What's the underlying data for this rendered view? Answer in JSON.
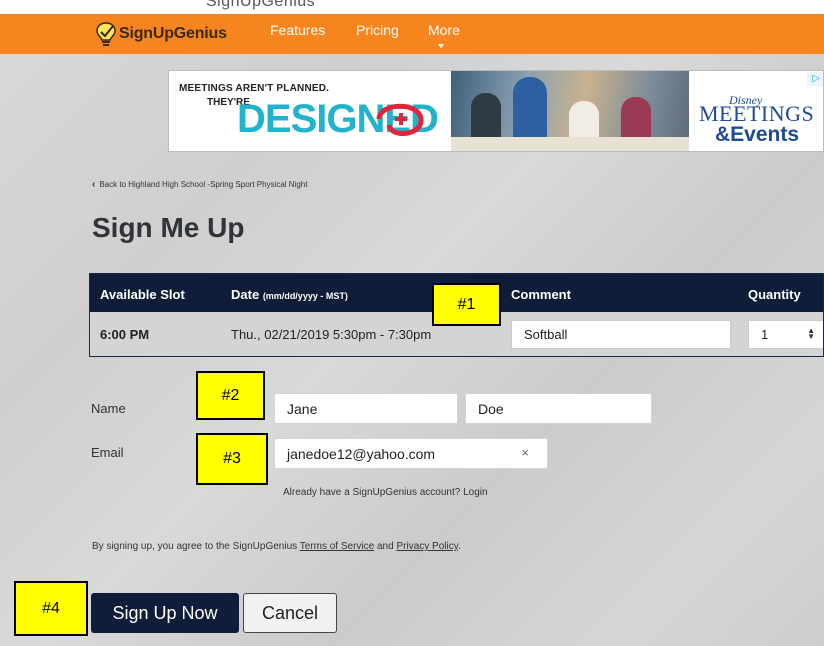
{
  "top_strip": {
    "text": "SignUpGenius"
  },
  "nav": {
    "logo_text": "SignUpGenius",
    "items": [
      {
        "label": "Features"
      },
      {
        "label": "Pricing"
      },
      {
        "label": "More"
      }
    ],
    "accent": "#f7851f"
  },
  "ad": {
    "line1": "MEETINGS AREN'T PLANNED.",
    "line2": "THEY'RE",
    "headline": "DESIGNED",
    "brand": "Disney",
    "meetings": "MEETINGS",
    "events": "&Events",
    "choice": "▷"
  },
  "back_link": "Back to Highland High School -Spring Sport Physical Night",
  "page_title": "Sign Me Up",
  "table": {
    "headers": {
      "slot": "Available Slot",
      "date": "Date",
      "date_sub": "(mm/dd/yyyy - MST)",
      "comment": "Comment",
      "quantity": "Quantity"
    },
    "row": {
      "slot": "6:00 PM",
      "date": "Thu., 02/21/2019 5:30pm - 7:30pm",
      "comment": "Softball",
      "quantity": "1"
    },
    "header_color": "#0f1d38"
  },
  "form": {
    "name_label": "Name",
    "first_name": "Jane",
    "last_name": "Doe",
    "email_label": "Email",
    "email": "janedoe12@yahoo.com",
    "clear": "×"
  },
  "login_prompt": "Already have a SignUpGenius account?",
  "login_link": "Login",
  "terms": {
    "prefix": "By signing up, you agree to the SignUpGenius",
    "tos": "Terms of Service",
    "and": "and",
    "privacy": "Privacy Policy",
    "suffix": "."
  },
  "buttons": {
    "signup": "Sign Up Now",
    "cancel": "Cancel"
  },
  "annotations": [
    "#1",
    "#2",
    "#3",
    "#4"
  ]
}
